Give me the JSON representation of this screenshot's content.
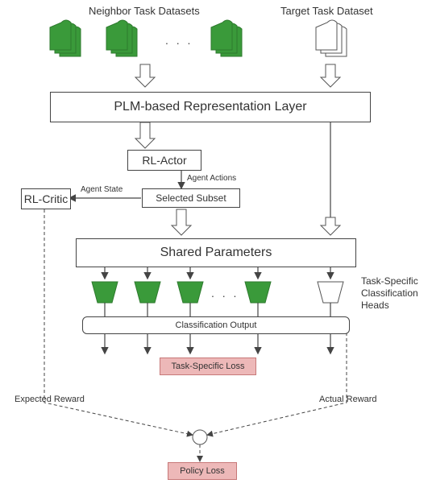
{
  "headers": {
    "neighbor": "Neighbor Task Datasets",
    "target": "Target Task Dataset",
    "dots": ". . ."
  },
  "plm_layer": "PLM-based Representation Layer",
  "rl_actor": "RL-Actor",
  "agent_actions": "Agent Actions",
  "selected_subset": "Selected Subset",
  "agent_state": "Agent State",
  "rl_critic": "RL-Critic",
  "shared_params": "Shared Parameters",
  "task_specific_heads": "Task-Specific\nClassification\nHeads",
  "class_output": "Classification Output",
  "task_loss": "Task-Specific Loss",
  "expected_reward": "Expected Reward",
  "actual_reward": "Actual Reward",
  "policy_loss": "Policy Loss",
  "colors": {
    "green": "#3a9a3a",
    "green_dark": "#2e7a2e",
    "pink": "#edb8b8"
  },
  "chart_data": {
    "type": "diagram",
    "nodes": [
      {
        "id": "neighbor_datasets",
        "label": "Neighbor Task Datasets",
        "kind": "stacked-docs",
        "color": "green",
        "count": 3
      },
      {
        "id": "target_dataset",
        "label": "Target Task Dataset",
        "kind": "stacked-docs",
        "color": "white",
        "count": 1
      },
      {
        "id": "plm",
        "label": "PLM-based Representation Layer",
        "kind": "box"
      },
      {
        "id": "rl_actor",
        "label": "RL-Actor",
        "kind": "box"
      },
      {
        "id": "selected_subset",
        "label": "Selected Subset",
        "kind": "box"
      },
      {
        "id": "rl_critic",
        "label": "RL-Critic",
        "kind": "box"
      },
      {
        "id": "shared_params",
        "label": "Shared Parameters",
        "kind": "box"
      },
      {
        "id": "heads_neighbor",
        "label": "Task-Specific Classification Heads (neighbor)",
        "kind": "trapezoid",
        "color": "green",
        "count": 3
      },
      {
        "id": "head_target",
        "label": "Task-Specific Classification Head (target)",
        "kind": "trapezoid",
        "color": "white",
        "count": 1
      },
      {
        "id": "class_output",
        "label": "Classification Output",
        "kind": "box"
      },
      {
        "id": "task_loss",
        "label": "Task-Specific Loss",
        "kind": "loss",
        "color": "pink"
      },
      {
        "id": "policy_loss",
        "label": "Policy Loss",
        "kind": "loss",
        "color": "pink"
      },
      {
        "id": "reward_combine",
        "label": "",
        "kind": "circle"
      }
    ],
    "edges": [
      {
        "from": "neighbor_datasets",
        "to": "plm",
        "style": "block-arrow"
      },
      {
        "from": "target_dataset",
        "to": "plm",
        "style": "block-arrow"
      },
      {
        "from": "plm",
        "to": "rl_actor",
        "label": "",
        "style": "block-arrow"
      },
      {
        "from": "rl_actor",
        "to": "selected_subset",
        "label": "Agent Actions",
        "style": "line-arrow"
      },
      {
        "from": "selected_subset",
        "to": "rl_critic",
        "label": "Agent State",
        "style": "line-arrow"
      },
      {
        "from": "selected_subset",
        "to": "shared_params",
        "style": "block-arrow"
      },
      {
        "from": "plm",
        "to": "shared_params",
        "style": "block-arrow",
        "note": "target path right side"
      },
      {
        "from": "shared_params",
        "to": "heads_neighbor",
        "style": "fanout"
      },
      {
        "from": "shared_params",
        "to": "head_target",
        "style": "fanout"
      },
      {
        "from": "heads_neighbor",
        "to": "class_output",
        "style": "line"
      },
      {
        "from": "head_target",
        "to": "class_output",
        "style": "line"
      },
      {
        "from": "class_output",
        "to": "task_loss",
        "style": "line-arrow",
        "multi": true
      },
      {
        "from": "rl_critic",
        "to": "reward_combine",
        "label": "Expected Reward",
        "style": "dashed-arrow"
      },
      {
        "from": "head_target",
        "to": "reward_combine",
        "label": "Actual Reward",
        "style": "dashed-arrow"
      },
      {
        "from": "reward_combine",
        "to": "policy_loss",
        "style": "dashed-arrow"
      }
    ]
  }
}
